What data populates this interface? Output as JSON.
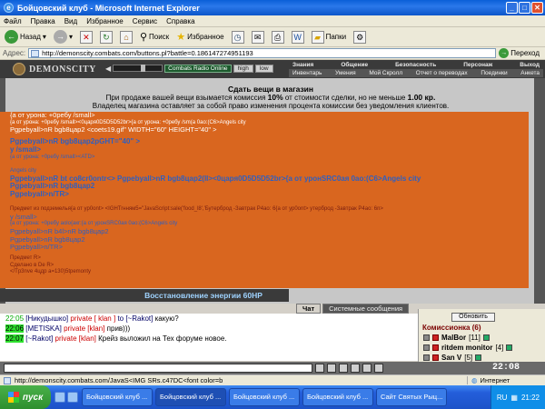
{
  "window": {
    "title": "Бойцовский клуб - Microsoft Internet Explorer"
  },
  "menu": [
    "Файл",
    "Правка",
    "Вид",
    "Избранное",
    "Сервис",
    "Справка"
  ],
  "toolbar": {
    "back": "Назад",
    "search": "Поиск",
    "favorites": "Избранное",
    "folders": "Папки"
  },
  "address": {
    "label": "Адрес:",
    "url": "http://demonscity.combats.com/buttons.pl?battle=0.186147274951193",
    "go": "Переход"
  },
  "game": {
    "logo": "DEMONSCITY",
    "radio_label": "Combats Radio Online",
    "quality_high": "high",
    "quality_low": "low",
    "nav_top": [
      "Знания",
      "Общение",
      "Безопасность",
      "Персонаж",
      "Выход"
    ],
    "nav_bottom": [
      "Инвентарь",
      "Умения",
      "Мой Скролл",
      "Отчет о переводах",
      "Поединки",
      "Анкета"
    ]
  },
  "shop": {
    "title": "Сдать вещи в магазин",
    "line1_pre": "При продаже вашей вещи взымается комиссия ",
    "line1_pct": "10%",
    "line1_mid": " от стоимости сделки, но не меньше ",
    "line1_amt": "1.00 кр.",
    "line2": "Владелец магазина оставляет за собой право изменения процента комиссии без уведомления клиентов."
  },
  "junk": {
    "l1": "{а от урона: +0ребу /small>",
    "l2": "{а от урона: +0ребу /small><0царя0D5D5D52br>{а от урона: +0ребу /sm(а 0ао:(С6>Angels city",
    "l3": "Pgрebуall>nR bgb8цар2 <coets19.gif\" WIDTH=\"60\" HEIGHT=\"40\" >",
    "l4": "Pgрebуall>nR bgb8цар2pGHT=\"40\" >",
    "l5": "у /small>",
    "l6": "{а от урона: +0ребу /small><ATD>",
    "l7": "Angels city",
    "l8": "Pgрebуall>nR bt co8cr0ontr<> Pgрebуall>nR bgb8цар2(Il><0царя0D5D5D52br>{а от уронSRC0ая 0ао:(С6>Angels city",
    "l9": "Pgрebуall>nR bgb8цар2",
    "l10": "Pgрebуall>n/TR>",
    "l11": "Предмет из подземелья{а от ур0ont> <IGHTrнням5=\"JavaScript:sale('food_l8','Бутерброд -Завтрак Р4ао: 6{а от ур0ont> утерброд -Завтрак Р4ао: 6n>",
    "l12": "у /small>",
    "l13": "{а от урона: +0ребу aolo{акr:{а от уронSRC0ая 0ао:(С6>Angels city",
    "l14": "Pgрebуall>nR b4l>nR bgb8цар2",
    "l15": "Pgрebуall>nR bgb8цар2",
    "l16": "Pgрebуall>n/TR>",
    "l17": "Предмет R>",
    "l18": "Сделано в De R>",
    "l19": "</Tp3nve 4цдр а=130)5tpemonty"
  },
  "restore": "Восстановление энергии 60HP",
  "tabs": {
    "chat": "Чат",
    "system": "Системные сообщения"
  },
  "chat": [
    {
      "time": "22:05",
      "user": "[Никудышко]",
      "priv": "private [ klan ]",
      "to": "to [~Rakot]",
      "text": "какую?",
      "hl": false
    },
    {
      "time": "22:06",
      "user": "[METISKA]",
      "priv": "private [klan]",
      "to": "",
      "text": "прив)))",
      "hl": true
    },
    {
      "time": "22:07",
      "user": "[~Rakot]",
      "priv": "private [klan]",
      "to": "",
      "text": "Крейз выложил на Тех форуме новое.",
      "hl": true
    }
  ],
  "right": {
    "refresh": "Обновить",
    "room": "Комиссионка (6)",
    "users": [
      {
        "name": "MalBor",
        "lvl": "[11]",
        "rank": "red"
      },
      {
        "name": "ritdem monitor",
        "lvl": "[4]",
        "rank": "red"
      },
      {
        "name": "San V",
        "lvl": "[5]",
        "rank": "red"
      }
    ]
  },
  "clock": "22:08",
  "status": {
    "url": "http://demonscity.combats.com/JavaS<IMG SRs.c47DC<font color=b",
    "zone": "Интернет"
  },
  "taskbar": {
    "start": "пуск",
    "tasks": [
      "Бойцовский клуб ...",
      "Бойцовский клуб ...",
      "Бойцовский клуб ...",
      "Бойцовский клуб ...",
      "Сайт Святых Рыц...",
      "Бойцовский клуб ..."
    ],
    "lang": "RU",
    "time": "21:22"
  }
}
